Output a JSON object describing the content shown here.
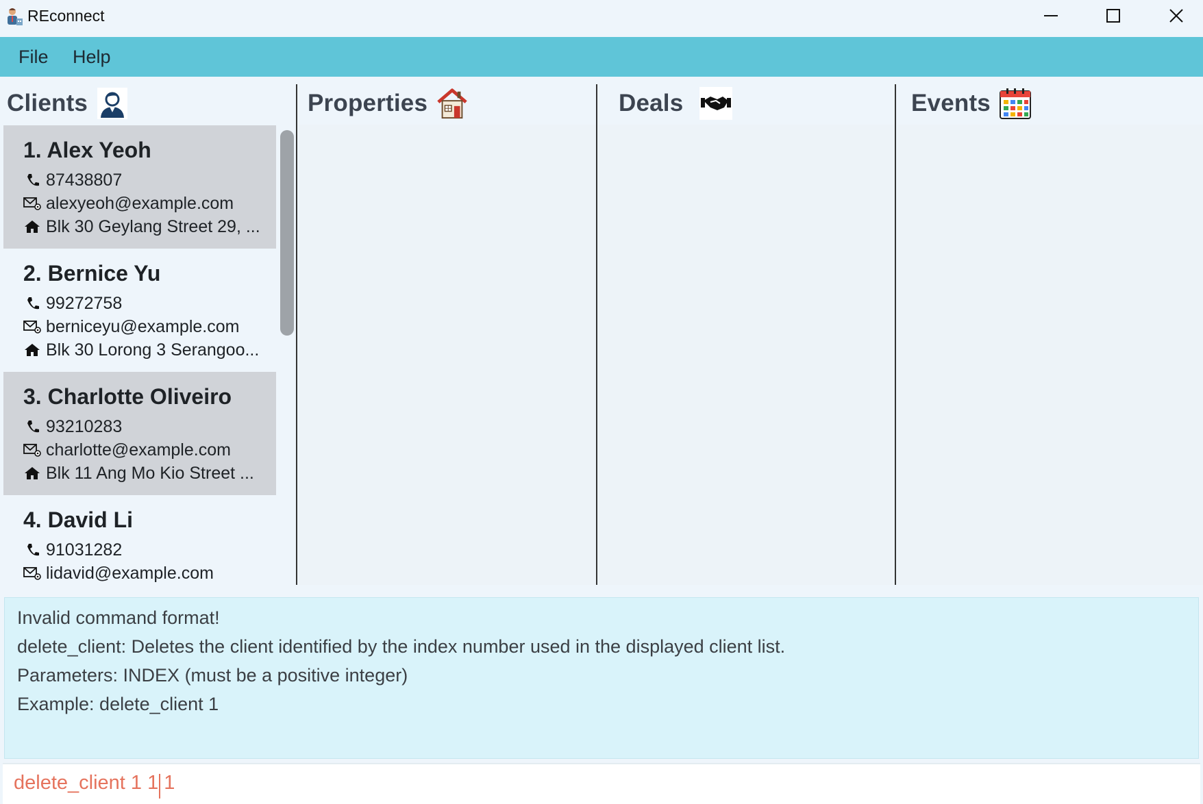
{
  "window": {
    "title": "REconnect"
  },
  "menu": {
    "file": "File",
    "help": "Help"
  },
  "panels": {
    "clients": "Clients",
    "properties": "Properties",
    "deals": "Deals",
    "events": "Events"
  },
  "clients": [
    {
      "name": "1. Alex Yeoh",
      "phone": "87438807",
      "email": "alexyeoh@example.com",
      "address": "Blk 30 Geylang Street 29, ..."
    },
    {
      "name": "2. Bernice Yu",
      "phone": "99272758",
      "email": "berniceyu@example.com",
      "address": "Blk 30 Lorong 3 Serangoo..."
    },
    {
      "name": "3. Charlotte Oliveiro",
      "phone": "93210283",
      "email": "charlotte@example.com",
      "address": "Blk 11 Ang Mo Kio Street ..."
    },
    {
      "name": "4. David Li",
      "phone": "91031282",
      "email": "lidavid@example.com",
      "address": ""
    }
  ],
  "result": {
    "lines": [
      "Invalid command format!",
      "delete_client: Deletes the client identified by the index number used in the displayed client list.",
      "Parameters: INDEX (must be a positive integer)",
      "Example: delete_client 1"
    ]
  },
  "command": {
    "value": "delete_client 1 1 1"
  },
  "colors": {
    "menubar": "#5fc5d8",
    "card_selected": "#d0d3d8",
    "result_bg": "#d9f3fa",
    "command_text": "#e5735d"
  },
  "icons": {
    "clients": "person-icon",
    "properties": "house-icon",
    "deals": "handshake-icon",
    "events": "calendar-icon",
    "phone": "phone-icon",
    "email": "email-icon",
    "address": "home-icon"
  }
}
